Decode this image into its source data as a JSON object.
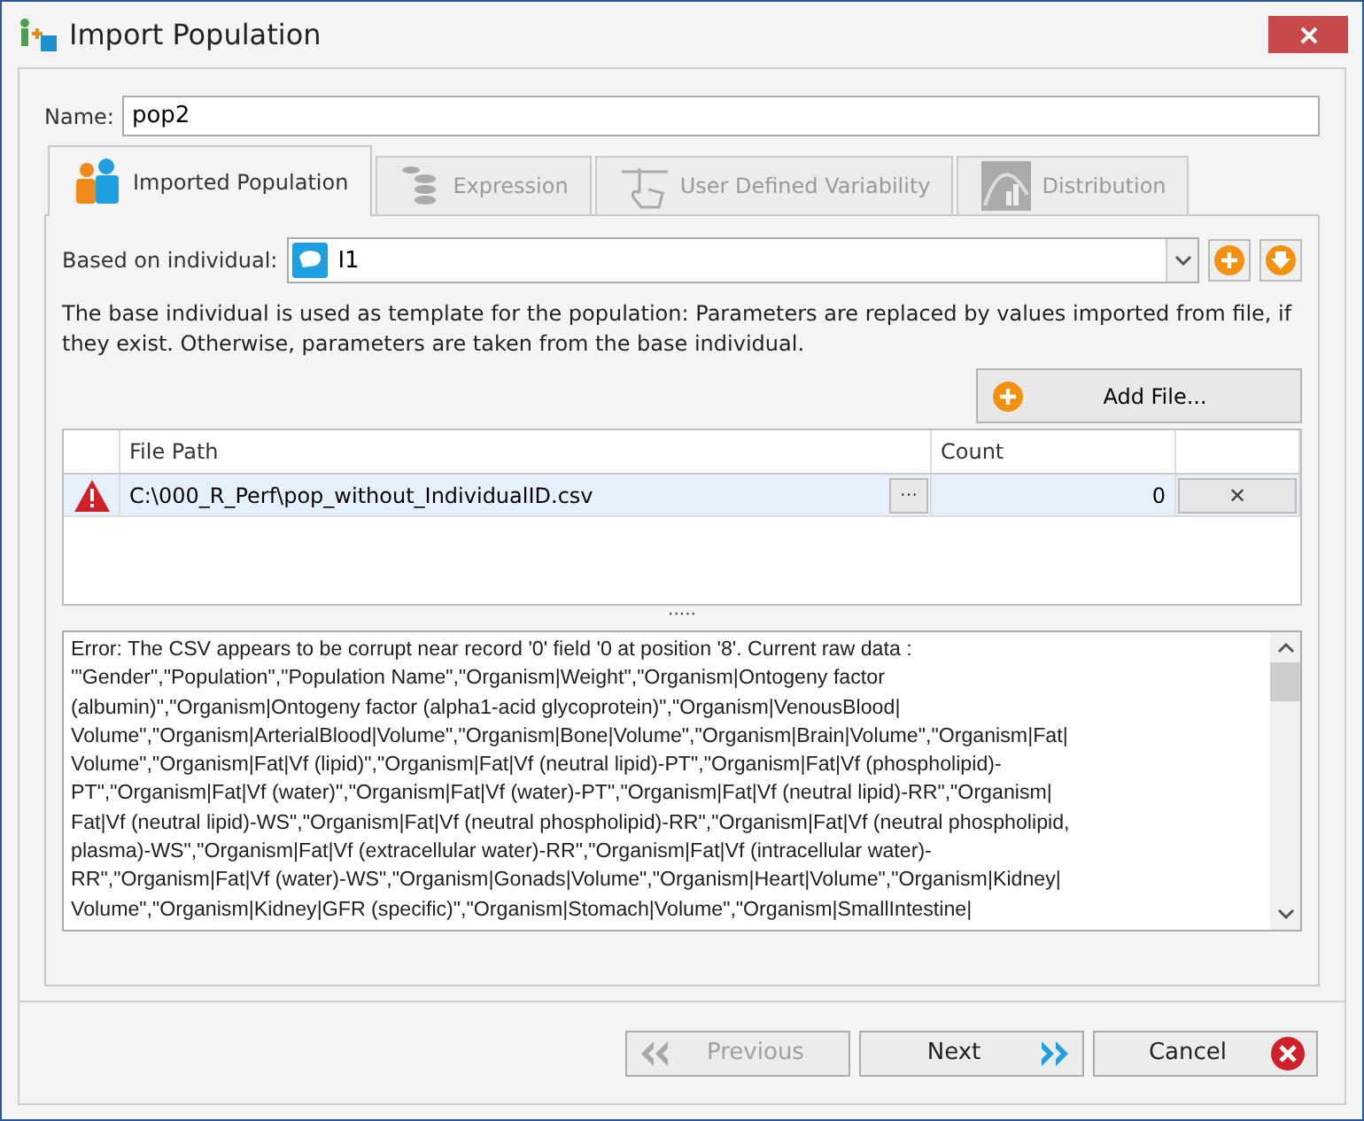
{
  "window": {
    "title": "Import Population"
  },
  "name_field": {
    "label": "Name:",
    "value": "pop2"
  },
  "tabs": [
    {
      "label": "Imported Population",
      "selected": true,
      "disabled": false,
      "kind": "people"
    },
    {
      "label": "Expression",
      "selected": false,
      "disabled": true,
      "kind": "coins"
    },
    {
      "label": "User Defined Variability",
      "selected": false,
      "disabled": true,
      "kind": "hand"
    },
    {
      "label": "Distribution",
      "selected": false,
      "disabled": true,
      "kind": "chart"
    }
  ],
  "based_on": {
    "label": "Based on individual:",
    "value": "I1"
  },
  "description": "The base individual is used as template for the population: Parameters are replaced by values imported from file, if they exist. Otherwise, parameters are taken from the base individual.",
  "add_file_button": "Add File...",
  "table": {
    "columns": [
      "File Path",
      "Count"
    ],
    "rows": [
      {
        "error": true,
        "path": "C:\\000_R_Perf\\pop_without_IndividualID.csv",
        "browse": "···",
        "count": "0",
        "remove": "✕"
      }
    ]
  },
  "splitter": "·····",
  "log_lines": [
    "Error: The CSV appears to be corrupt near record '0' field '0 at position '8'. Current raw data :",
    "'\"Gender\",\"Population\",\"Population Name\",\"Organism|Weight\",\"Organism|Ontogeny factor",
    "(albumin)\",\"Organism|Ontogeny factor (alpha1-acid glycoprotein)\",\"Organism|VenousBlood|",
    "Volume\",\"Organism|ArterialBlood|Volume\",\"Organism|Bone|Volume\",\"Organism|Brain|Volume\",\"Organism|Fat|",
    "Volume\",\"Organism|Fat|Vf (lipid)\",\"Organism|Fat|Vf (neutral lipid)-PT\",\"Organism|Fat|Vf (phospholipid)-",
    "PT\",\"Organism|Fat|Vf (water)\",\"Organism|Fat|Vf (water)-PT\",\"Organism|Fat|Vf (neutral lipid)-RR\",\"Organism|",
    "Fat|Vf (neutral lipid)-WS\",\"Organism|Fat|Vf (neutral phospholipid)-RR\",\"Organism|Fat|Vf (neutral phospholipid,",
    "plasma)-WS\",\"Organism|Fat|Vf (extracellular water)-RR\",\"Organism|Fat|Vf (intracellular water)-",
    "RR\",\"Organism|Fat|Vf (water)-WS\",\"Organism|Gonads|Volume\",\"Organism|Heart|Volume\",\"Organism|Kidney|",
    "Volume\",\"Organism|Kidney|GFR (specific)\",\"Organism|Stomach|Volume\",\"Organism|SmallIntestine|"
  ],
  "footer_buttons": [
    {
      "label": "Previous",
      "kind": "previous",
      "disabled": true
    },
    {
      "label": "Next",
      "kind": "next",
      "disabled": false
    },
    {
      "label": "Cancel",
      "kind": "cancel",
      "disabled": false
    }
  ]
}
